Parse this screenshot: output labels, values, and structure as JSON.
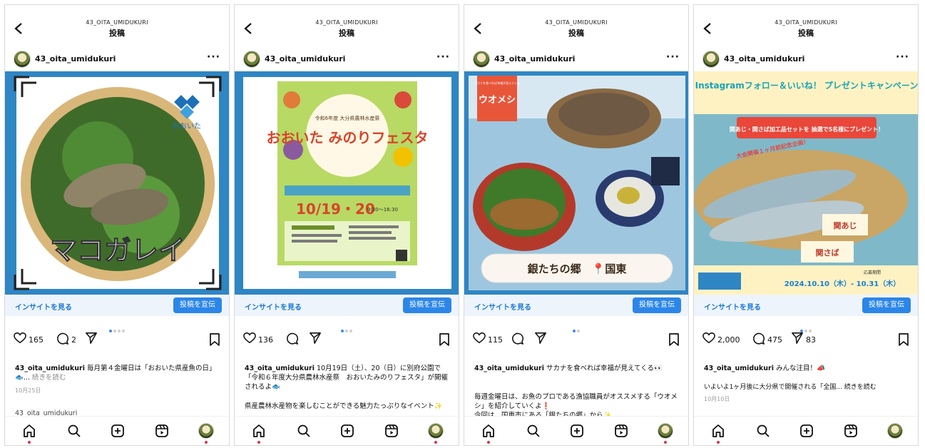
{
  "header": {
    "username": "43_OITA_UMIDUKURI",
    "title": "投稿"
  },
  "account": "43_oita_umidukuri",
  "insight_label": "インサイトを見る",
  "promote_label": "投稿を宣伝",
  "icons": [
    "back-arrow-icon",
    "more-icon",
    "heart-icon",
    "comment-icon",
    "share-icon",
    "bookmark-icon",
    "home-icon",
    "search-icon",
    "create-icon",
    "reels-icon"
  ],
  "colors": {
    "accent_blue": "#2c86e8",
    "frame_blue": "#2f86c4",
    "notification_red": "#e0304a"
  },
  "posts": [
    {
      "image_text": "マコガレイ",
      "image_logo": "おおいた",
      "carousel_dots": 4,
      "active_dot": 1,
      "likes": "165",
      "comments": "2",
      "shares": "",
      "caption": "毎月第４金曜日は「おおいた県産魚の日」🐟... 続きを読む",
      "caption_more": "続きを読む",
      "caption_body": "毎月第４金曜日は「おおいた県産魚の日」🐟...",
      "date": "10月25日",
      "next_user": "43_oita_umidukuri"
    },
    {
      "image_title": "おおいた みのりフェスタ",
      "image_subtitle": "令和6年度 大分県農林水産祭",
      "image_date": "10/19・20",
      "image_time": "9:30〜16:30",
      "carousel_dots": 3,
      "active_dot": 1,
      "likes": "136",
      "comments": "",
      "shares": "",
      "caption_body": "10月19日（土）、20（日）に別府公園で「令和６年度大分県農林水産祭　おおいたみのりフェスタ」が開催されるよ🐟",
      "caption_line2": "県産農林水産物を楽しむことができる魅力たっぷりなイベント✨"
    },
    {
      "image_label": "ウオメシ",
      "image_label_small": "サカナを食べれば幸福が見えてくる",
      "image_caption": "銀たちの郷　📍国東",
      "carousel_dots": 2,
      "active_dot": 1,
      "likes": "115",
      "comments": "",
      "shares": "",
      "caption_body": "サカナを食べれば幸福が見えてくる👀",
      "caption_line2": "毎週金曜日は、お魚のプロである漁協職員がオススメする「ウオメシ」を紹介していくよ❗",
      "caption_line3": "今回は、国東市にある「銀たちの郷」から✨"
    },
    {
      "image_title": "Instagramフォロー＆いいね！ プレゼントキャンペーン",
      "image_banner": "関あじ・関さば加工品セットを 抽選で5名様にプレゼント！",
      "image_badge": "大会開催１ヶ月前記念企画！",
      "image_period_label": "応募期間",
      "image_period": "2024.10.10（木）- 10.31（木）",
      "image_product1": "関あじ",
      "image_product2": "関さば",
      "carousel_dots": 3,
      "active_dot": 0,
      "likes": "2,000",
      "comments": "475",
      "shares": "83",
      "caption_body": "みんな注目！📣",
      "caption_line2": "いよいよ1ヶ月後に大分県で開催される「全国... 続きを読む",
      "caption_more": "続きを読む",
      "date": "10月10日"
    }
  ]
}
